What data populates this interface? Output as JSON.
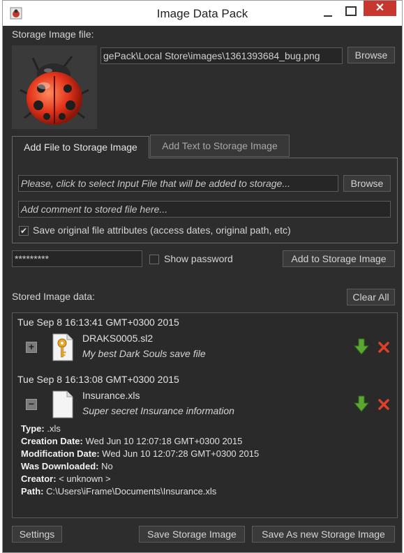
{
  "window": {
    "title": "Image Data Pack",
    "close_glyph": "✕"
  },
  "storage": {
    "label": "Storage Image file:",
    "path": "gePack\\Local Store\\images\\1361393684_bug.png",
    "browse_label": "Browse",
    "preview_icon": "ladybug-icon"
  },
  "tabs": [
    {
      "label": "Add File to Storage Image",
      "active": true
    },
    {
      "label": "Add Text to Storage Image",
      "active": false
    }
  ],
  "add_file": {
    "input_placeholder": "Please, click to select Input File that will be added to storage...",
    "browse_label": "Browse",
    "comment_placeholder": "Add comment to stored file here...",
    "save_attributes_label": "Save original file attributes (access dates, original path, etc)",
    "save_attributes_checked": true,
    "check_glyph": "✔"
  },
  "password": {
    "value": "*********",
    "show_label": "Show password",
    "show_checked": false
  },
  "add_button_label": "Add to Storage Image",
  "stored": {
    "label": "Stored Image data:",
    "clear_label": "Clear All",
    "entries": [
      {
        "date": "Tue Sep 8 16:13:41 GMT+0300 2015",
        "expander": "+",
        "icon": "key-file-icon",
        "name": "DRAKS0005.sl2",
        "comment": "My best Dark Souls save file"
      },
      {
        "date": "Tue Sep 8 16:13:08 GMT+0300 2015",
        "expander": "−",
        "icon": "document-icon",
        "name": "Insurance.xls",
        "comment": "Super secret Insurance information",
        "details": [
          {
            "key": "Type:",
            "value": ".xls"
          },
          {
            "key": "Creation Date:",
            "value": "Wed Jun 10 12:07:18 GMT+0300 2015"
          },
          {
            "key": "Modification Date:",
            "value": "Wed Jun 10 12:07:28 GMT+0300 2015"
          },
          {
            "key": "Was Downloaded:",
            "value": "No"
          },
          {
            "key": "Creator:",
            "value": "< unknown >"
          },
          {
            "key": "Path:",
            "value": "C:\\Users\\iFrame\\Documents\\Insurance.xls"
          }
        ]
      }
    ]
  },
  "footer": {
    "settings_label": "Settings",
    "save_label": "Save Storage Image",
    "save_as_label": "Save As new Storage Image"
  },
  "colors": {
    "background": "#2d2d2d",
    "close_button": "#c7372f",
    "download_green": "#5aa832",
    "delete_red": "#e0402a"
  }
}
